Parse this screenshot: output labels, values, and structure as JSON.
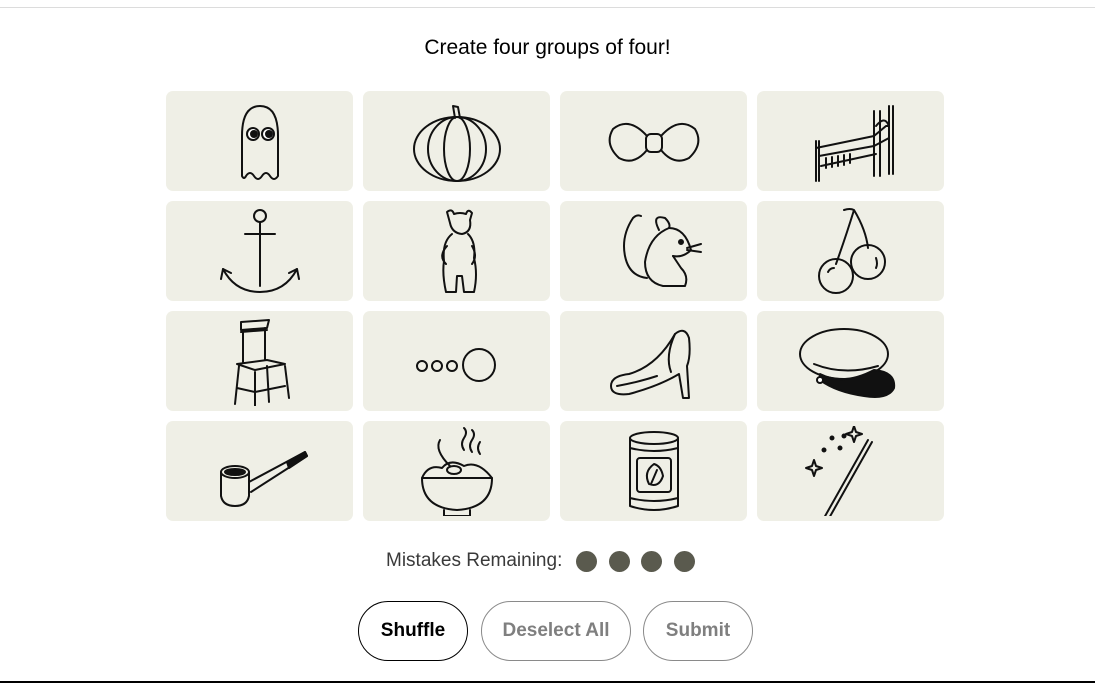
{
  "header": {
    "prompt": "Create four groups of four!"
  },
  "tiles": [
    {
      "icon": "ghost-icon"
    },
    {
      "icon": "pumpkin-icon"
    },
    {
      "icon": "bow-tie-icon"
    },
    {
      "icon": "bed-icon"
    },
    {
      "icon": "anchor-icon"
    },
    {
      "icon": "bear-icon"
    },
    {
      "icon": "mouse-icon"
    },
    {
      "icon": "cherries-icon"
    },
    {
      "icon": "chair-icon"
    },
    {
      "icon": "growing-circles-icon"
    },
    {
      "icon": "glass-slipper-icon"
    },
    {
      "icon": "captain-hat-icon"
    },
    {
      "icon": "smoking-pipe-icon"
    },
    {
      "icon": "porridge-bowl-icon"
    },
    {
      "icon": "tin-can-icon"
    },
    {
      "icon": "magic-wand-icon"
    }
  ],
  "status": {
    "mistakes_label": "Mistakes Remaining:",
    "mistakes_remaining": 4,
    "dot_color": "#5a5a4e"
  },
  "controls": {
    "shuffle_label": "Shuffle",
    "deselect_label": "Deselect All",
    "submit_label": "Submit"
  },
  "colors": {
    "tile_bg": "#efefe6",
    "text": "#000000",
    "disabled_text": "#7f7f7f"
  }
}
